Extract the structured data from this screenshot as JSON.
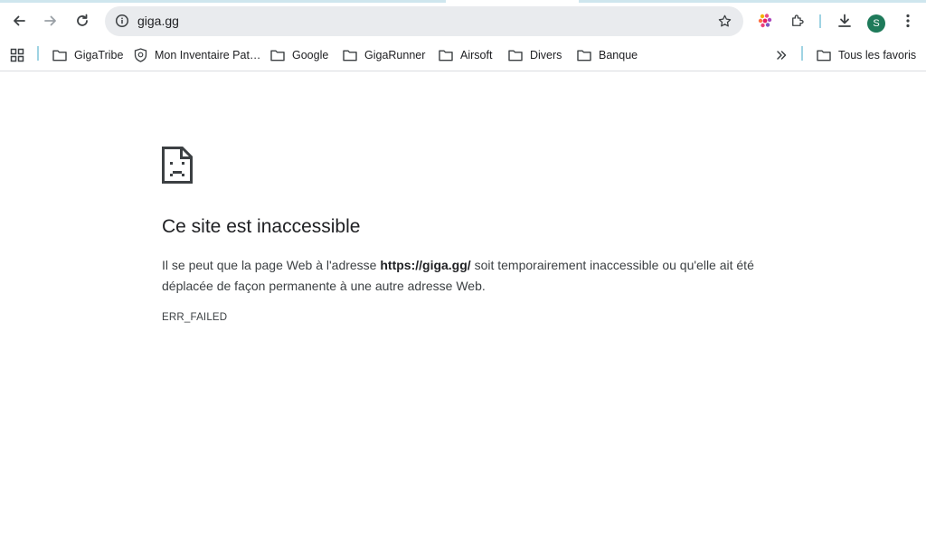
{
  "browser": {
    "url": "giga.gg",
    "avatar_letter": "S",
    "accent_color": "#1e7a5a"
  },
  "icons": {
    "back": "arrow-left-icon",
    "forward": "arrow-right-icon",
    "reload": "reload-icon",
    "info": "info-icon",
    "star": "star-icon",
    "extension": "puzzle-icon",
    "download": "download-icon",
    "menu": "kebab-menu-icon",
    "apps": "apps-grid-icon",
    "folder": "folder-icon"
  },
  "bookmarks": {
    "items": [
      {
        "label": "GigaTribe",
        "icon": "folder-icon"
      },
      {
        "label": "Mon Inventaire Pat…",
        "icon": "shield-icon"
      },
      {
        "label": "Google",
        "icon": "folder-icon"
      },
      {
        "label": "GigaRunner",
        "icon": "folder-icon"
      },
      {
        "label": "Airsoft",
        "icon": "folder-icon"
      },
      {
        "label": "Divers",
        "icon": "folder-icon"
      },
      {
        "label": "Banque",
        "icon": "folder-icon"
      }
    ],
    "all_favorites": "Tous les favoris"
  },
  "error": {
    "title": "Ce site est inaccessible",
    "desc_before": "Il se peut que la page Web à l'adresse ",
    "desc_url": "https://giga.gg/",
    "desc_after": " soit temporairement inaccessible ou qu'elle ait été déplacée de façon permanente à une autre adresse Web.",
    "code": "ERR_FAILED"
  }
}
